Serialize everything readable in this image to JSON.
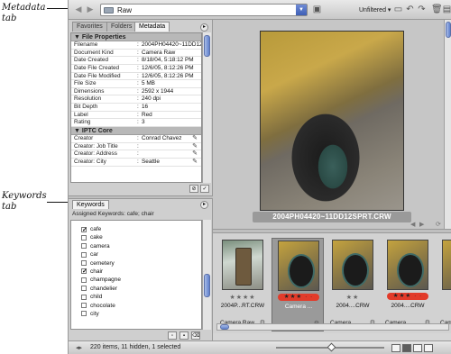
{
  "callouts": {
    "metadata_tab": "Metadata\ntab",
    "keywords_tab": "Keywords\ntab"
  },
  "toolbar": {
    "path": "Raw",
    "filter": "Unfiltered"
  },
  "tabs": [
    "Favorites",
    "Folders",
    "Metadata"
  ],
  "metadata": {
    "file_properties_title": "File Properties",
    "file_properties": [
      {
        "k": "Filename",
        "v": "2004PH04420~11DD12..."
      },
      {
        "k": "Document Kind",
        "v": "Camera Raw"
      },
      {
        "k": "Date Created",
        "v": "8/18/04, 5:18:12 PM"
      },
      {
        "k": "Date File Created",
        "v": "12/6/05, 8:12:26 PM"
      },
      {
        "k": "Date File Modified",
        "v": "12/6/05, 8:12:26 PM"
      },
      {
        "k": "File Size",
        "v": "5 MB"
      },
      {
        "k": "Dimensions",
        "v": "2592 x 1944"
      },
      {
        "k": "Resolution",
        "v": "240 dpi"
      },
      {
        "k": "Bit Depth",
        "v": "16"
      },
      {
        "k": "Label",
        "v": "Red"
      },
      {
        "k": "Rating",
        "v": "3"
      }
    ],
    "iptc_title": "IPTC Core",
    "iptc": [
      {
        "k": "Creator",
        "v": "Conrad Chavez"
      },
      {
        "k": "Creator: Job Title",
        "v": ""
      },
      {
        "k": "Creator: Address",
        "v": ""
      },
      {
        "k": "Creator: City",
        "v": "Seattle"
      }
    ]
  },
  "keywords": {
    "tab": "Keywords",
    "assigned": "Assigned Keywords: cafe; chair",
    "items": [
      {
        "label": "cafe",
        "checked": true
      },
      {
        "label": "cake",
        "checked": false
      },
      {
        "label": "camera",
        "checked": false
      },
      {
        "label": "car",
        "checked": false
      },
      {
        "label": "cemetery",
        "checked": false
      },
      {
        "label": "chair",
        "checked": true
      },
      {
        "label": "champagne",
        "checked": false
      },
      {
        "label": "chandelier",
        "checked": false
      },
      {
        "label": "child",
        "checked": false
      },
      {
        "label": "chocolate",
        "checked": false
      },
      {
        "label": "city",
        "checked": false
      }
    ]
  },
  "preview": {
    "caption": "2004PH04420~11DD12SPRT.CRW"
  },
  "filmstrip": [
    {
      "stars": "★★★★",
      "name": "2004P...RT.CRW",
      "owner": "Camera Raw",
      "label": false,
      "selected": false,
      "alt": true
    },
    {
      "stars": "★★★ · ·",
      "name": "Camera ...",
      "owner": "",
      "label": true,
      "selected": true,
      "alt": false
    },
    {
      "stars": "★★",
      "name": "2004....CRW",
      "owner": "Camera ...",
      "label": false,
      "selected": false,
      "alt": false
    },
    {
      "stars": "★★★ · ·",
      "name": "2004....CRW",
      "owner": "Camera ...",
      "label": true,
      "selected": false,
      "alt": false
    },
    {
      "stars": "★★",
      "name": "200...",
      "owner": "Cam",
      "label": false,
      "selected": false,
      "alt": false
    }
  ],
  "status": {
    "text": "220 items, 11 hidden, 1 selected"
  }
}
